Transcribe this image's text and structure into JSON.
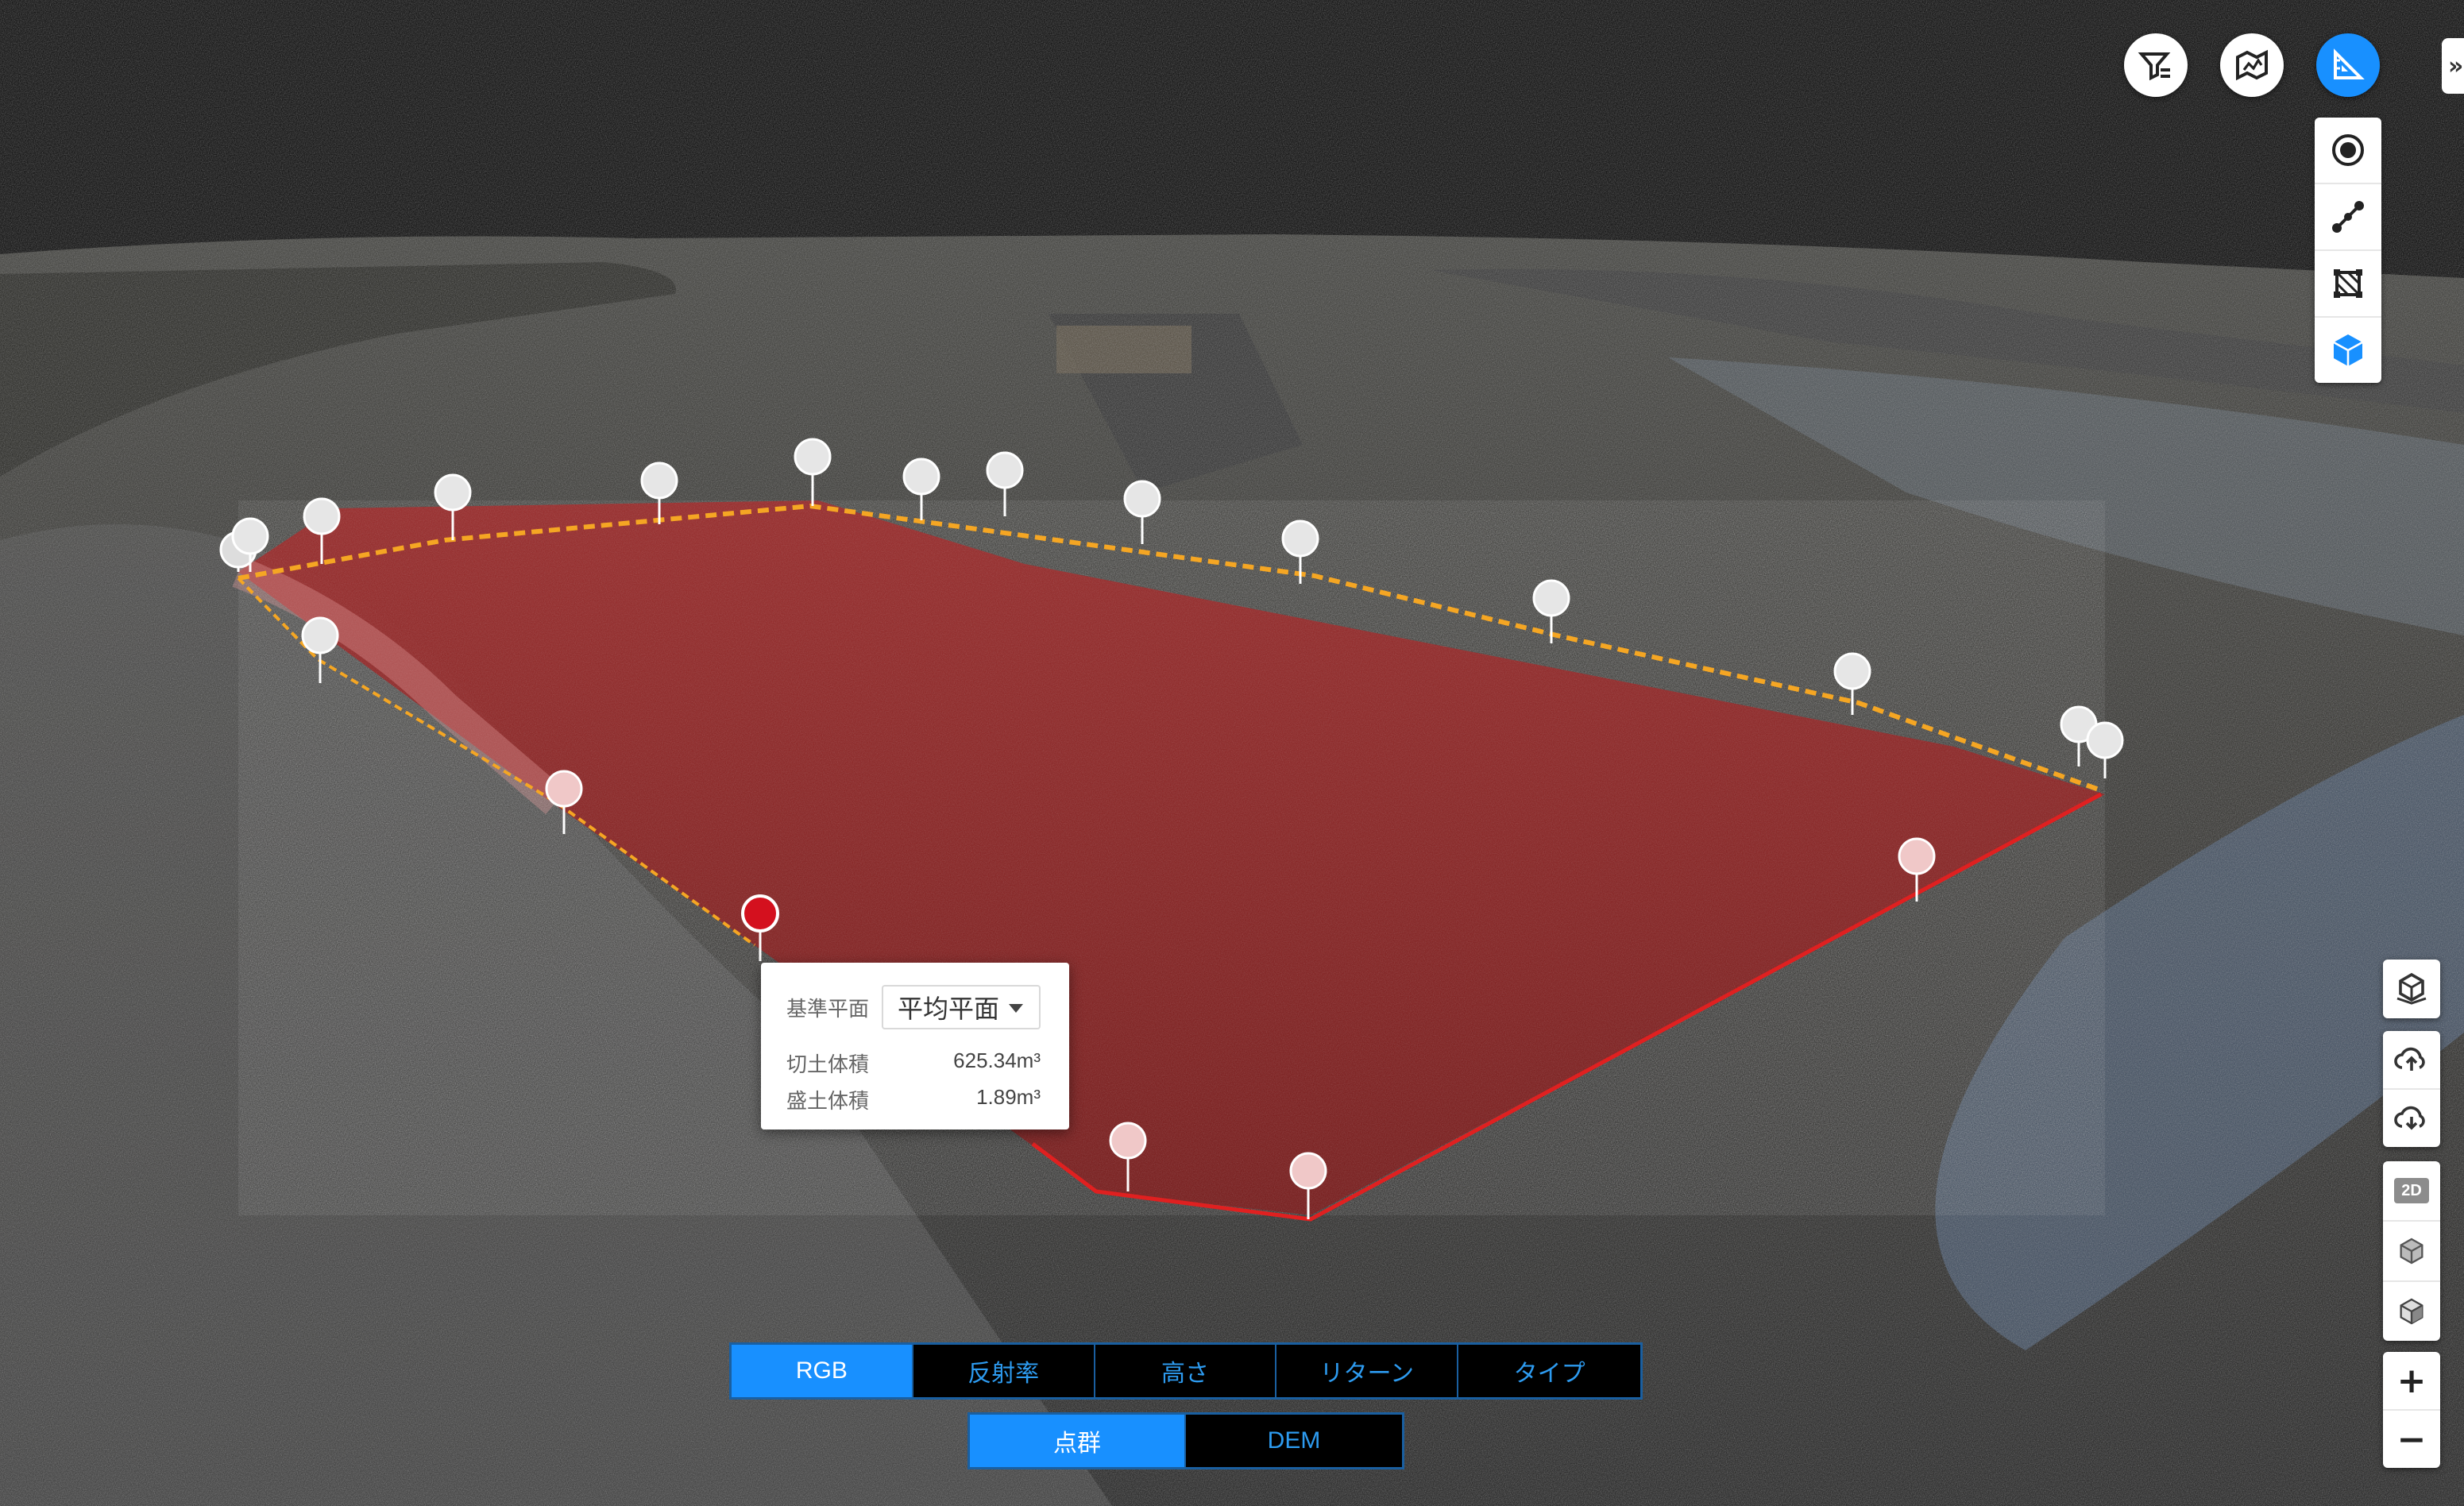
{
  "top_toolbar": {
    "filter_icon": "filter-icon",
    "map_icon": "map-layers-icon",
    "measure_icon": "measure-ruler-icon",
    "collapse_label": "»"
  },
  "measure_tools": [
    "point-marker-icon",
    "polyline-icon",
    "area-polygon-icon",
    "volume-cube-icon"
  ],
  "right_toolbar": [
    "model-view-icon",
    "cloud-upload-icon",
    "cloud-download-icon",
    "2d-view-icon",
    "3d-view-icon",
    "3d-model-icon"
  ],
  "badge_2d": "2D",
  "zoom": {
    "in": "+",
    "out": "−"
  },
  "volume_popup": {
    "reference_label": "基準平面",
    "reference_value": "平均平面",
    "cut_label": "切土体積",
    "cut_value": "625.34m³",
    "fill_label": "盛土体積",
    "fill_value": "1.89m³"
  },
  "color_modes": {
    "options": [
      "RGB",
      "反射率",
      "高さ",
      "リターン",
      "タイプ"
    ],
    "selected": "RGB"
  },
  "data_modes": {
    "options": [
      "点群",
      "DEM"
    ],
    "selected": "点群"
  },
  "colors": {
    "accent": "#1890ff",
    "region_fill": "#8b1a1a",
    "boundary": "#f5a623",
    "selected_marker": "#d4101e"
  }
}
